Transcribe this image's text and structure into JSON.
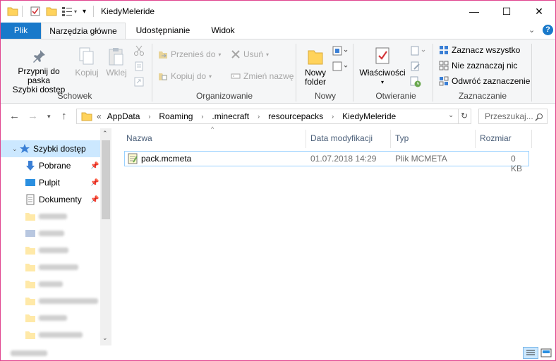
{
  "window": {
    "title": "KiedyMeleride",
    "minimize": "—",
    "maximize": "☐",
    "close": "✕"
  },
  "tabs": [
    {
      "label": "Plik"
    },
    {
      "label": "Narzędzia główne"
    },
    {
      "label": "Udostępnianie"
    },
    {
      "label": "Widok"
    }
  ],
  "ribbon": {
    "schowek": {
      "label": "Schowek",
      "pin_line1": "Przypnij do paska",
      "pin_line2": "Szybki dostęp",
      "copy": "Kopiuj",
      "paste": "Wklej"
    },
    "organizuj": {
      "label": "Organizowanie",
      "move_to": "Przenieś do",
      "copy_to": "Kopiuj do",
      "delete": "Usuń",
      "rename": "Zmień nazwę"
    },
    "nowy": {
      "label": "Nowy",
      "new_folder_line1": "Nowy",
      "new_folder_line2": "folder"
    },
    "otwieranie": {
      "label": "Otwieranie",
      "properties": "Właściwości"
    },
    "zaznaczanie": {
      "label": "Zaznaczanie",
      "select_all": "Zaznacz wszystko",
      "select_none": "Nie zaznaczaj nic",
      "invert": "Odwróć zaznaczenie"
    }
  },
  "address": {
    "overflow": "«",
    "crumbs": [
      "AppData",
      "Roaming",
      ".minecraft",
      "resourcepacks",
      "KiedyMeleride"
    ],
    "search_placeholder": "Przeszukaj..."
  },
  "sidebar": {
    "items": [
      {
        "label": "Szybki dostęp"
      },
      {
        "label": "Pobrane"
      },
      {
        "label": "Pulpit"
      },
      {
        "label": "Dokumenty"
      }
    ]
  },
  "columns": [
    "Nazwa",
    "Data modyfikacji",
    "Typ",
    "Rozmiar"
  ],
  "files": [
    {
      "name": "pack.mcmeta",
      "modified": "01.07.2018 14:29",
      "type": "Plik MCMETA",
      "size": "0 KB"
    }
  ],
  "colors": {
    "accent": "#1979ca",
    "selection_border": "#99d1ff",
    "window_border": "#e0458f",
    "folder": "#ffd35c"
  }
}
